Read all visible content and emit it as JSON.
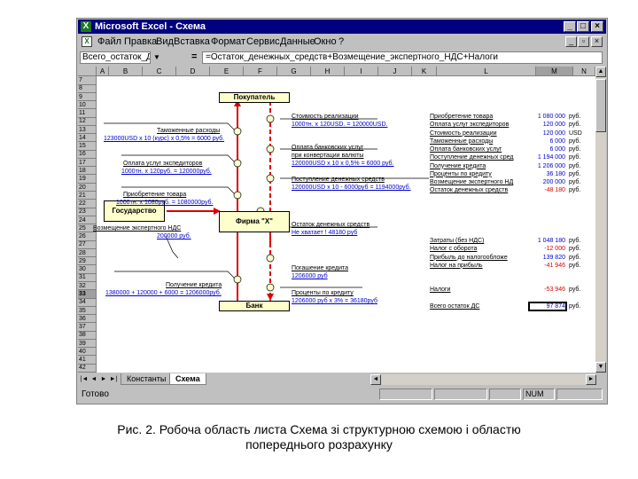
{
  "window": {
    "title": "Microsoft Excel - Схема",
    "btn_min": "_",
    "btn_max": "□",
    "btn_close": "×"
  },
  "menu": [
    "Файл",
    "Правка",
    "Вид",
    "Вставка",
    "Формат",
    "Сервис",
    "Данные",
    "Окно",
    "?"
  ],
  "formula_bar": {
    "name_box": "Всего_остаток_ДС",
    "eq": "=",
    "formula": "=Остаток_денежных_средств+Возмещение_экспертного_НДС+Налоги"
  },
  "columns": [
    "A",
    "B",
    "C",
    "D",
    "E",
    "F",
    "G",
    "H",
    "I",
    "J",
    "K",
    "L",
    "M",
    "N"
  ],
  "rows": [
    "7",
    "8",
    "9",
    "10",
    "11",
    "12",
    "13",
    "14",
    "15",
    "16",
    "17",
    "18",
    "19",
    "20",
    "21",
    "22",
    "23",
    "24",
    "25",
    "26",
    "27",
    "28",
    "29",
    "30",
    "31",
    "32",
    "33",
    "34",
    "35",
    "36",
    "37",
    "38",
    "39",
    "40",
    "41",
    "42"
  ],
  "diagram": {
    "boxes": {
      "buyer": "Покупатель",
      "state": "Государство",
      "firm": "Фирма \"Х\"",
      "bank": "Банк"
    },
    "left_labels": [
      {
        "title": "Таможенные расходы",
        "value": "123000USD х 10 (курс) х 0,5% = 6000 руб."
      },
      {
        "title": "Оплата услуг экспедиторов",
        "value": "1000тн. х 120руб. = 120000руб."
      },
      {
        "title": "Приобретение товара",
        "value": "1000тн. х 1080руб. = 1080000руб."
      },
      {
        "title": "Возмещение экспертного НДС",
        "value": "200000 руб."
      },
      {
        "title": "Получение кредита",
        "value": "1380000 + 120000 + 6000 = 1206000руб."
      }
    ],
    "right_labels": [
      {
        "title": "Стоимость реализации",
        "value": "1000тн. х 120USD. = 120000USD."
      },
      {
        "title": "Оплата банковских услуг",
        "title2": "при конвертации валюты",
        "value": "120000USD х 10 х 0,5% = 6000 руб."
      },
      {
        "title": "Поступление денежных средств",
        "value": "120000USD х 10 - 6000руб = 1194000руб."
      },
      {
        "title": "Остаток денежных средств",
        "value": "Не хватает ! 48180 руб"
      },
      {
        "title": "Погашение кредита",
        "value": "1206000 руб"
      },
      {
        "title": "Проценты по кредиту",
        "value": "1206000 руб х 3% = 36180руб"
      }
    ]
  },
  "summary1": [
    {
      "label": "Приобретение товара",
      "value": "1 080 000",
      "unit": "руб.",
      "color": "#0000cc"
    },
    {
      "label": "Оплата услуг экспедиторов",
      "value": "120 000",
      "unit": "руб.",
      "color": "#0000cc"
    },
    {
      "label": "Стоимость реализации",
      "value": "120 000",
      "unit": "USD",
      "color": "#0000cc"
    },
    {
      "label": "Таможенные расходы",
      "value": "6 000",
      "unit": "руб.",
      "color": "#0000cc"
    },
    {
      "label": "Оплата банковских услуг",
      "value": "6 000",
      "unit": "руб.",
      "color": "#0000cc"
    },
    {
      "label": "Поступление денежных сред",
      "value": "1 194 000",
      "unit": "руб.",
      "color": "#0000cc"
    },
    {
      "label": "Получение кредита",
      "value": "1 206 000",
      "unit": "руб.",
      "color": "#0000cc"
    },
    {
      "label": "Проценты по кредиту",
      "value": "36 180",
      "unit": "руб.",
      "color": "#0000cc"
    },
    {
      "label": "Возмещение экспертного НД",
      "value": "200 000",
      "unit": "руб.",
      "color": "#0000cc"
    },
    {
      "label": "Остаток денежных средств",
      "value": "-48 180",
      "unit": "руб.",
      "color": "#dd0000"
    }
  ],
  "summary2": [
    {
      "label": "Затраты (без НДС)",
      "value": "1 048 180",
      "unit": "руб.",
      "color": "#0000cc"
    },
    {
      "label": "Налог с оборота",
      "value": "-12 000",
      "unit": "руб.",
      "color": "#dd0000"
    },
    {
      "label": "Прибыль до налогообложе",
      "value": "139 820",
      "unit": "руб.",
      "color": "#0000cc"
    },
    {
      "label": "Налог на прибыль",
      "value": "-41 946",
      "unit": "руб.",
      "color": "#dd0000"
    }
  ],
  "taxes": {
    "label": "Налоги",
    "value": "-53 946",
    "unit": "руб."
  },
  "total": {
    "label": "Всего остаток ДС",
    "value": "97 874",
    "unit": "руб."
  },
  "tabs": {
    "nav": [
      "|◄",
      "◄",
      "►",
      "►|"
    ],
    "items": [
      "Константы",
      "Схема"
    ]
  },
  "status": {
    "ready": "Готово",
    "num": "NUM"
  },
  "caption": {
    "line1": "Рис. 2. Робоча область листа Схема зі структурною схемою і областю",
    "line2": "попереднього розрахунку"
  }
}
